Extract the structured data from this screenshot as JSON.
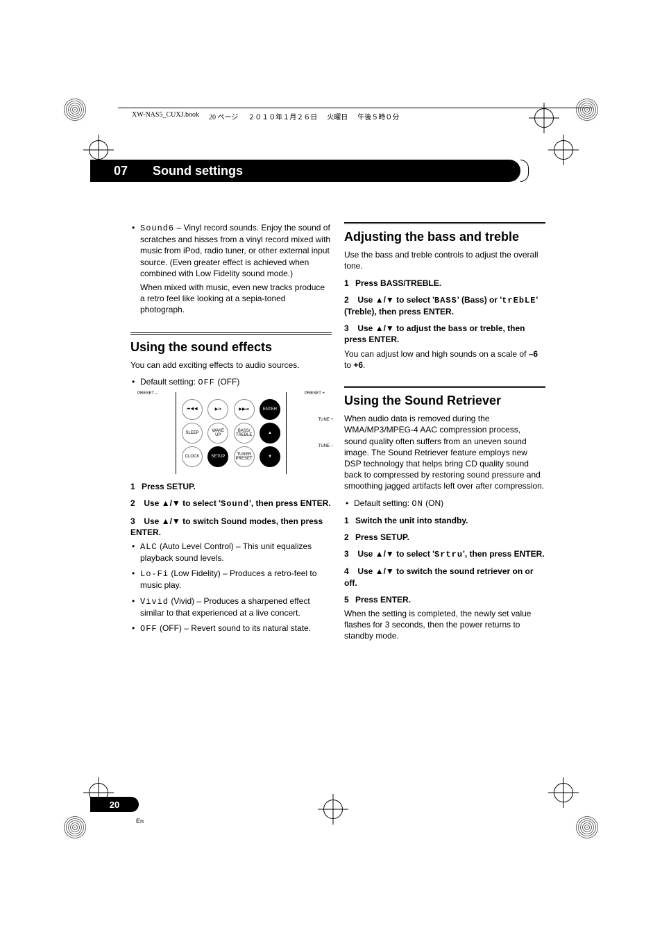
{
  "header": {
    "file": "XW-NAS5_CUXJ.book",
    "page_jp": "20 ページ",
    "date_jp": "２０１０年１月２６日",
    "weekday_jp": "火曜日",
    "time_jp": "午後５時０分"
  },
  "chapter": {
    "number": "07",
    "title": "Sound settings"
  },
  "left_col": {
    "sound6_item": {
      "label_seg": "Sound6",
      "desc1": " – Vinyl record sounds. Enjoy the sound of scratches and hisses from a vinyl record mixed with music from iPod, radio tuner, or other external input source. (Even greater effect is achieved when combined with Low Fidelity sound mode.)",
      "desc2": "When mixed with music, even new tracks produce a retro feel like looking at a sepia-toned photograph."
    },
    "effects": {
      "heading": "Using the sound effects",
      "intro": "You can add exciting effects to audio sources.",
      "default_label": "Default setting: ",
      "default_seg": "OFF",
      "default_paren": " (OFF)"
    },
    "remote": {
      "preset_minus": "PRESET –",
      "preset_plus": "PRESET +",
      "tune_plus": "TUNE +",
      "tune_minus": "TUNE –",
      "prev": "⏮◀◀",
      "play": "▶/⏸",
      "next": "▶▶⏭",
      "enter": "ENTER",
      "sleep": "SLEEP",
      "wake": "WAKE\nUP",
      "bass": "BASS/\nTREBLE",
      "up": "▲",
      "clock": "CLOCK",
      "setup": "SETUP",
      "tuner": "TUNER\nPRESET",
      "down": "▼"
    },
    "steps": {
      "s1": "Press SETUP.",
      "s2a": "Use ",
      "s2b": " to select '",
      "s2seg": "Sound",
      "s2c": "', then press ENTER.",
      "s3a": "Use ",
      "s3b": " to switch Sound modes, then press ENTER."
    },
    "modes": {
      "alc_seg": "ALC",
      "alc_txt": " (Auto Level Control) – This unit equalizes playback sound levels.",
      "lofi_seg": "Lo-Fi",
      "lofi_txt": " (Low Fidelity) – Produces a retro-feel to music play.",
      "vivid_seg": "Vivid",
      "vivid_txt": " (Vivid) – Produces a sharpened effect similar to that experienced at a live concert.",
      "off_seg": "OFF",
      "off_txt": " (OFF) – Revert sound to its natural state."
    }
  },
  "right_col": {
    "bass": {
      "heading": "Adjusting the bass and treble",
      "intro": "Use the bass and treble controls to adjust the overall tone.",
      "s1": "Press BASS/TREBLE.",
      "s2a": "Use ",
      "s2b": " to select '",
      "s2seg": "BASS",
      "s2c": "' (Bass) or '",
      "s2seg2": "trEbLE",
      "s2d": "' (Treble), then press ENTER.",
      "s3a": "Use ",
      "s3b": " to adjust the bass or treble, then press ENTER.",
      "note1": "You can adjust low and high sounds on a scale of ",
      "note_lo": "–6",
      "note_mid": " to ",
      "note_hi": "+6",
      "note_end": "."
    },
    "retriever": {
      "heading": "Using the Sound Retriever",
      "intro": "When audio data is removed during the WMA/MP3/MPEG-4 AAC compression process, sound quality often suffers from an uneven sound image. The Sound Retriever feature employs new DSP technology that helps bring CD quality sound back to compressed by restoring sound pressure and smoothing jagged artifacts left over after compression.",
      "default_label": "Default setting: ",
      "default_seg": "ON",
      "default_paren": " (ON)",
      "s1": "Switch the unit into standby.",
      "s2": "Press SETUP.",
      "s3a": "Use ",
      "s3b": " to select '",
      "s3seg": "Srtru",
      "s3c": "', then press ENTER.",
      "s4a": "Use ",
      "s4b": " to switch the sound retriever on or off.",
      "s5": "Press ENTER.",
      "outro": "When the setting is completed, the newly set value flashes for 3 seconds, then the power returns to standby mode."
    }
  },
  "arrows": "▲/▼",
  "page": {
    "num": "20",
    "lang": "En"
  }
}
